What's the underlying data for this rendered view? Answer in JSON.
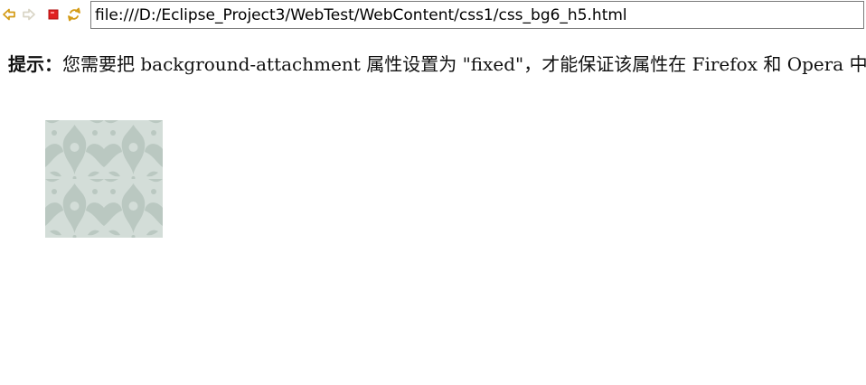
{
  "toolbar": {
    "back_icon": "back-arrow-icon",
    "forward_icon": "forward-arrow-icon",
    "stop_icon": "stop-icon",
    "refresh_icon": "refresh-icon",
    "url": "file:///D:/Eclipse_Project3/WebTest/WebContent/css1/css_bg6_h5.html"
  },
  "content": {
    "hint_label": "提示：",
    "hint_text": "您需要把 background-attachment 属性设置为 \"fixed\"，才能保证该属性在 Firefox 和 Opera 中正常工作。",
    "pattern_image": "damask-pattern"
  },
  "colors": {
    "back_arrow": "#d49b16",
    "forward_arrow": "#d9d5c6",
    "stop": "#e02020",
    "refresh": "#d49b16",
    "pattern_bg": "#d3ddd8",
    "pattern_fg": "#bac8c1"
  }
}
